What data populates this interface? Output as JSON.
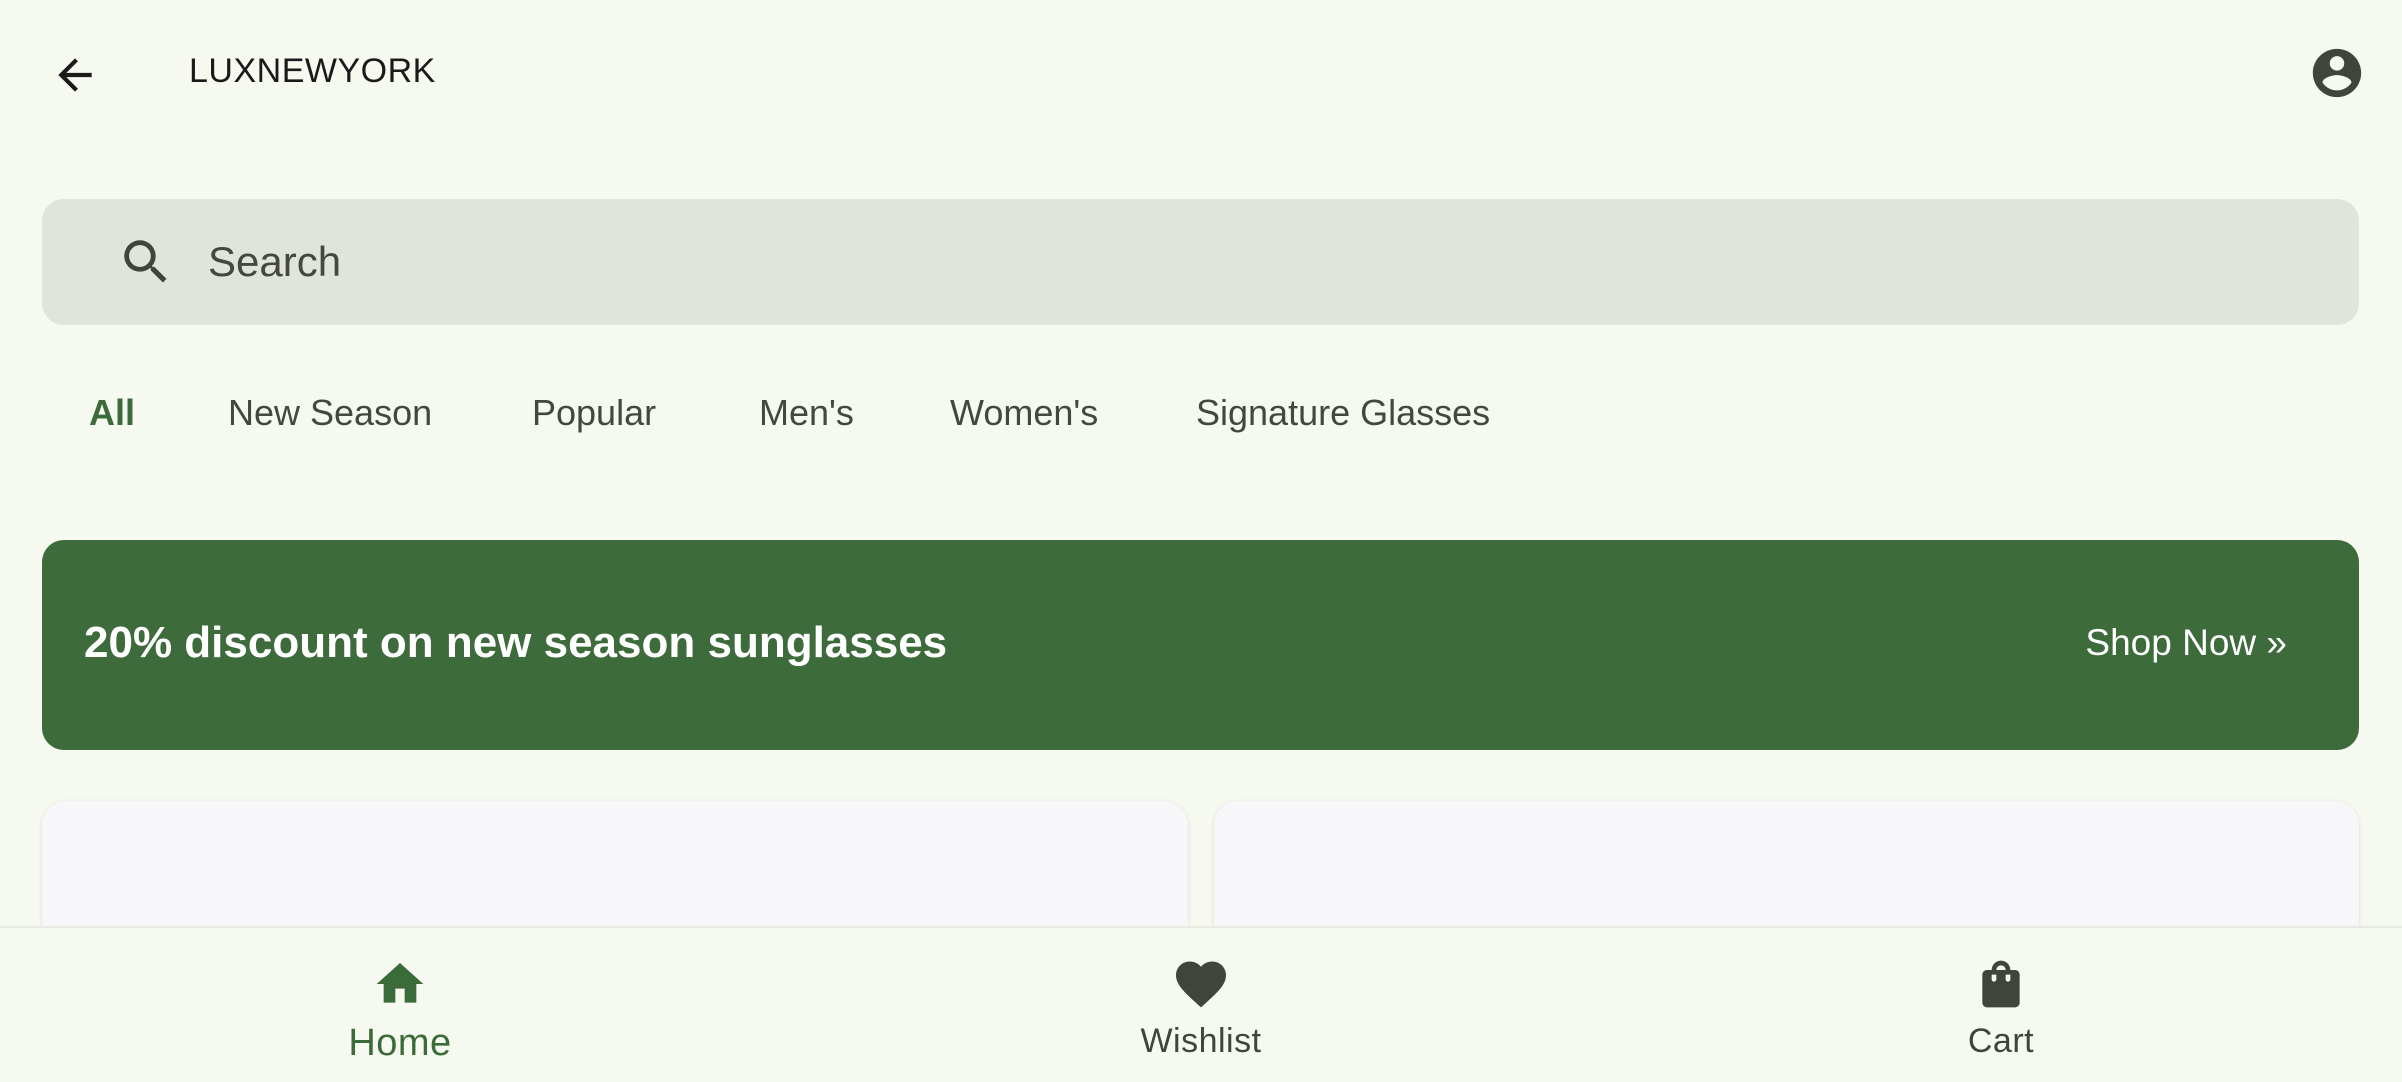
{
  "header": {
    "brand": "LUXNEWYORK"
  },
  "search": {
    "placeholder": "Search"
  },
  "categories": {
    "items": [
      "All",
      "New Season",
      "Popular",
      "Men's",
      "Women's",
      "Signature Glasses"
    ],
    "active_index": 0
  },
  "promo": {
    "text": "20% discount on new season sunglasses",
    "cta": "Shop Now »"
  },
  "bottom_nav": {
    "items": [
      {
        "label": "Home",
        "icon": "home-icon",
        "active": true
      },
      {
        "label": "Wishlist",
        "icon": "heart-icon",
        "active": false
      },
      {
        "label": "Cart",
        "icon": "shopping-bag-icon",
        "active": false
      }
    ]
  },
  "colors": {
    "background": "#f6f9f0",
    "primary": "#3d6b3b",
    "search_bg": "#e1e4da",
    "text_muted": "#43483f"
  }
}
